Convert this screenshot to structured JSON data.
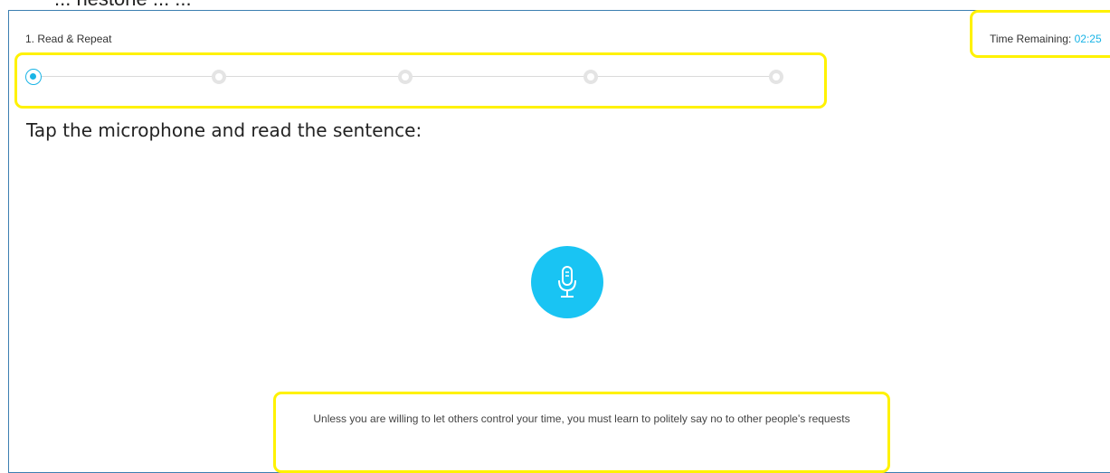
{
  "header_partial": "... nestone ... ...",
  "task": {
    "section_label": "1. Read & Repeat"
  },
  "timer": {
    "label": "Time Remaining:",
    "value": "02:25"
  },
  "progress": {
    "total_steps": 5,
    "current_step": 1
  },
  "prompt": {
    "instruction": "Tap the microphone and read the sentence:"
  },
  "mic": {
    "icon": "microphone-icon",
    "color": "#19c4f3"
  },
  "sentence": {
    "text": "Unless you are willing to let others control your time, you must learn to politely say no to other people's requests"
  },
  "colors": {
    "accent": "#19b4e6",
    "highlight": "#fff200",
    "panel_border": "#3c7fb1"
  }
}
